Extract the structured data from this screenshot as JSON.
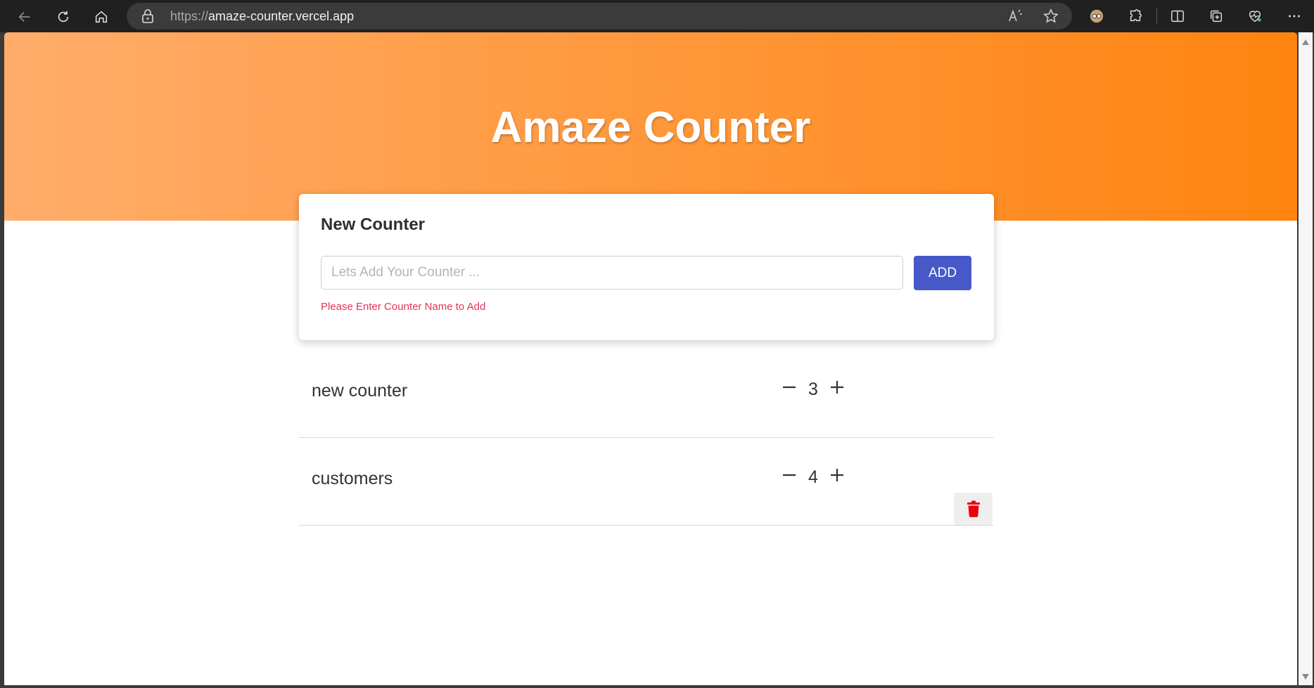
{
  "browser": {
    "url_scheme": "https://",
    "url_host": "amaze-counter.vercel.app"
  },
  "hero": {
    "title": "Amaze Counter"
  },
  "new_counter": {
    "heading": "New Counter",
    "placeholder": "Lets Add Your Counter ...",
    "value": "",
    "add_label": "ADD",
    "error": "Please Enter Counter Name to Add"
  },
  "counters": [
    {
      "name": "new counter",
      "count": "3"
    },
    {
      "name": "customers",
      "count": "4"
    }
  ],
  "colors": {
    "accent_from": "#ffad6b",
    "accent_to": "#ff8410",
    "button": "#4759c9",
    "error": "#e3335a",
    "delete": "#e8000b"
  }
}
